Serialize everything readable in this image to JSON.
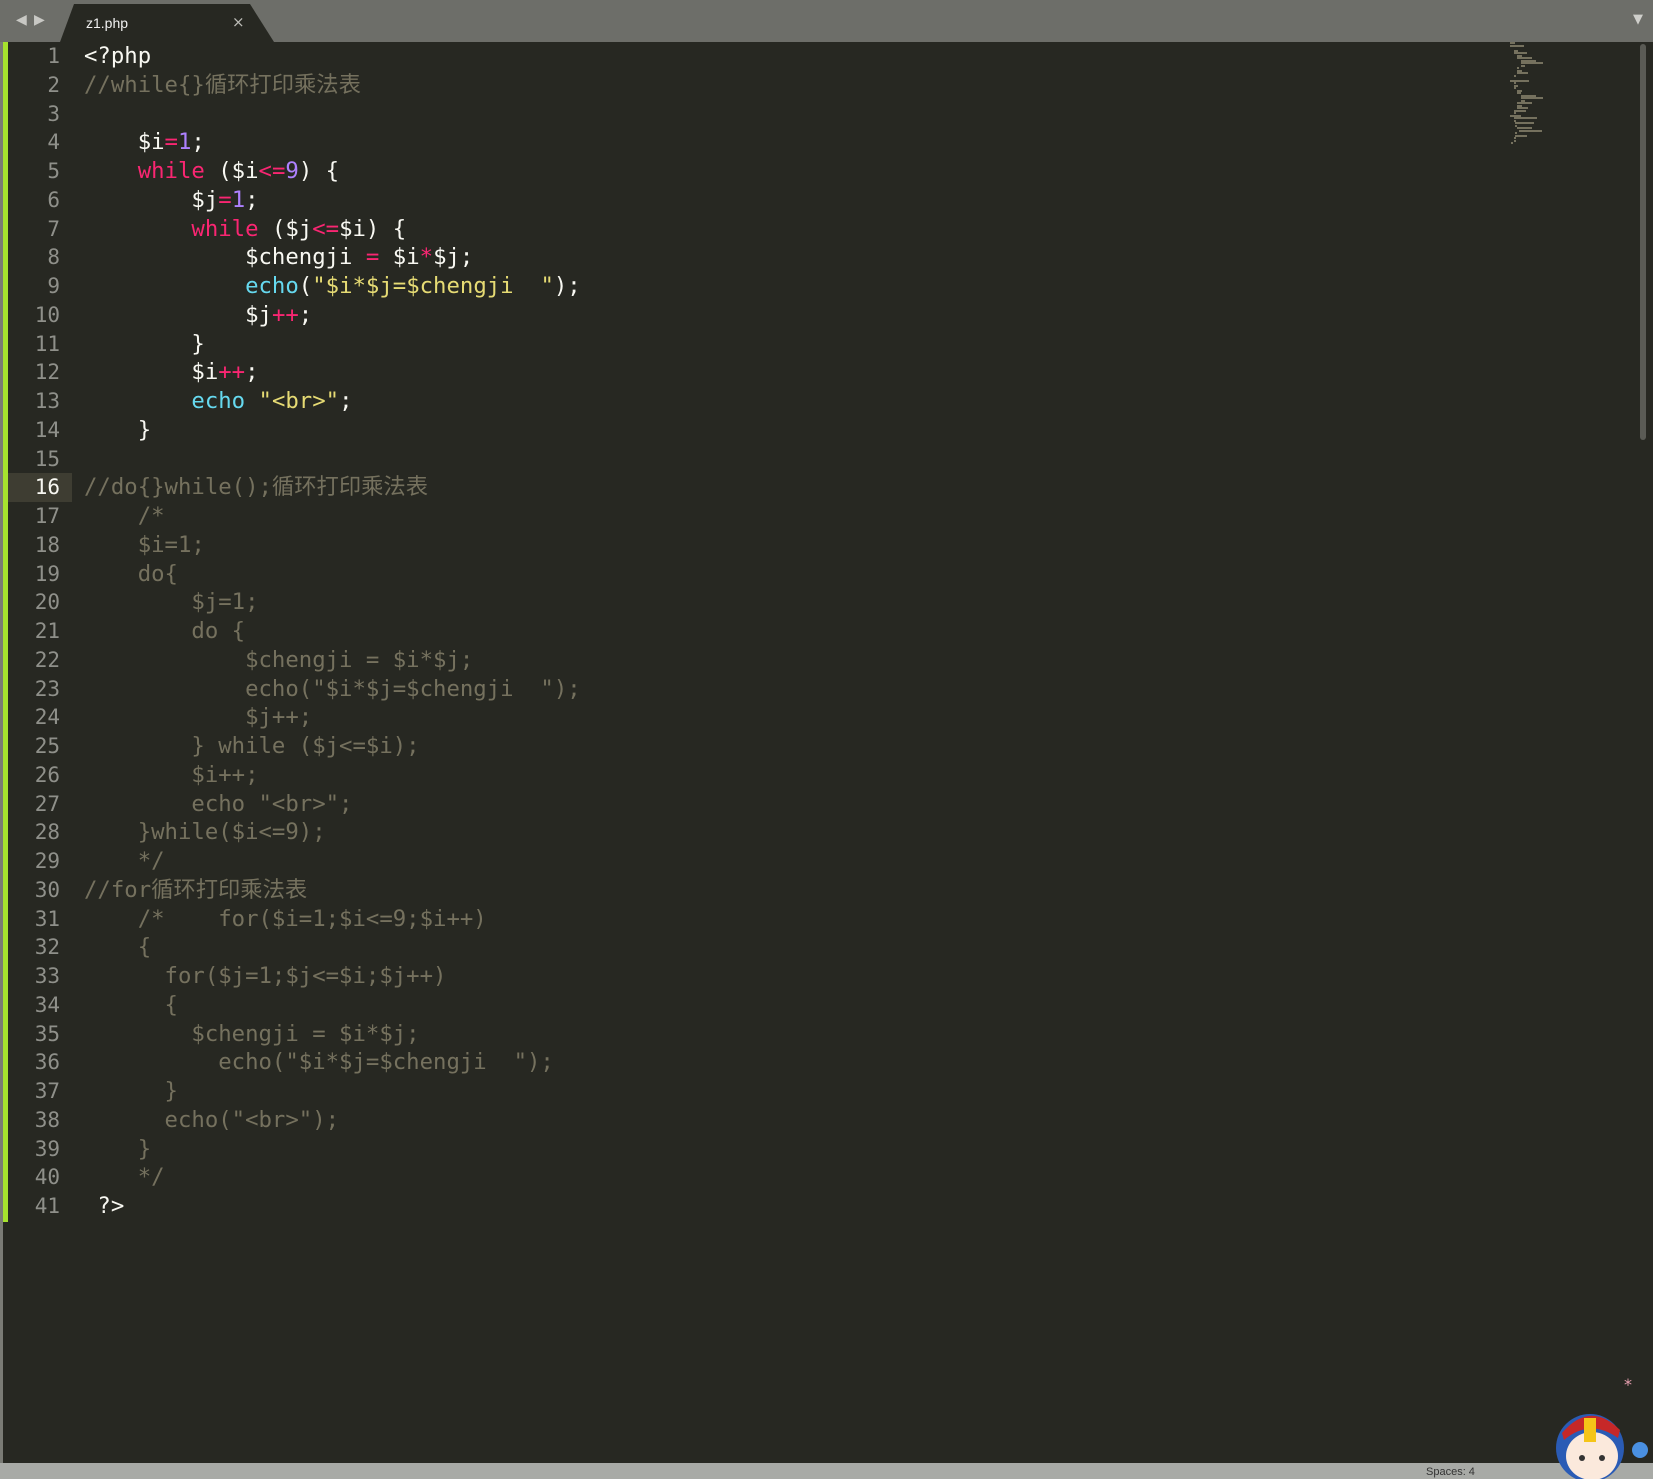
{
  "tab": {
    "filename": "z1.php",
    "close_glyph": "×"
  },
  "nav": {
    "back": "◀",
    "forward": "▶",
    "menu": "▼"
  },
  "status": {
    "spaces": "Spaces: 4"
  },
  "editor": {
    "current_line": 16,
    "lines": [
      [
        [
          "t",
          "<?php"
        ]
      ],
      [
        [
          "c",
          "//while{}循环打印乘法表"
        ]
      ],
      [],
      [
        [
          "t",
          "    $i"
        ],
        [
          "o",
          "="
        ],
        [
          "n",
          "1"
        ],
        [
          "t",
          ";"
        ]
      ],
      [
        [
          "k",
          "    while"
        ],
        [
          "t",
          " ($i"
        ],
        [
          "o",
          "<="
        ],
        [
          "n",
          "9"
        ],
        [
          "t",
          ") {"
        ]
      ],
      [
        [
          "t",
          "        $j"
        ],
        [
          "o",
          "="
        ],
        [
          "n",
          "1"
        ],
        [
          "t",
          ";"
        ]
      ],
      [
        [
          "k",
          "        while"
        ],
        [
          "t",
          " ($j"
        ],
        [
          "o",
          "<="
        ],
        [
          "t",
          "$i) {"
        ]
      ],
      [
        [
          "t",
          "            $chengji "
        ],
        [
          "o",
          "="
        ],
        [
          "t",
          " $i"
        ],
        [
          "o",
          "*"
        ],
        [
          "t",
          "$j;"
        ]
      ],
      [
        [
          "f",
          "            echo"
        ],
        [
          "t",
          "("
        ],
        [
          "s",
          "\"$i*$j=$chengji  \""
        ],
        [
          "t",
          ");"
        ]
      ],
      [
        [
          "t",
          "            $j"
        ],
        [
          "o",
          "++"
        ],
        [
          "t",
          ";"
        ]
      ],
      [
        [
          "t",
          "        }"
        ]
      ],
      [
        [
          "t",
          "        $i"
        ],
        [
          "o",
          "++"
        ],
        [
          "t",
          ";"
        ]
      ],
      [
        [
          "f",
          "        echo"
        ],
        [
          "t",
          " "
        ],
        [
          "s",
          "\"<br>\""
        ],
        [
          "t",
          ";"
        ]
      ],
      [
        [
          "t",
          "    }"
        ]
      ],
      [],
      [
        [
          "c",
          "//do{}while();循环打印乘法表"
        ]
      ],
      [
        [
          "c",
          "    /*"
        ]
      ],
      [
        [
          "c",
          "    $i=1;"
        ]
      ],
      [
        [
          "c",
          "    do{"
        ]
      ],
      [
        [
          "c",
          "        $j=1;"
        ]
      ],
      [
        [
          "c",
          "        do {"
        ]
      ],
      [
        [
          "c",
          "            $chengji = $i*$j;"
        ]
      ],
      [
        [
          "c",
          "            echo(\"$i*$j=$chengji  \");"
        ]
      ],
      [
        [
          "c",
          "            $j++;"
        ]
      ],
      [
        [
          "c",
          "        } while ($j<=$i);"
        ]
      ],
      [
        [
          "c",
          "        $i++;"
        ]
      ],
      [
        [
          "c",
          "        echo \"<br>\";"
        ]
      ],
      [
        [
          "c",
          "    }while($i<=9);"
        ]
      ],
      [
        [
          "c",
          "    */"
        ]
      ],
      [
        [
          "c",
          "//for循环打印乘法表"
        ]
      ],
      [
        [
          "c",
          "    /*    for($i=1;$i<=9;$i++)"
        ]
      ],
      [
        [
          "c",
          "    {"
        ]
      ],
      [
        [
          "c",
          "      for($j=1;$j<=$i;$j++)"
        ]
      ],
      [
        [
          "c",
          "      {"
        ]
      ],
      [
        [
          "c",
          "        $chengji = $i*$j;"
        ]
      ],
      [
        [
          "c",
          "          echo(\"$i*$j=$chengji  \");"
        ]
      ],
      [
        [
          "c",
          "      }"
        ]
      ],
      [
        [
          "c",
          "      echo(\"<br>\");"
        ]
      ],
      [
        [
          "c",
          "    }"
        ]
      ],
      [
        [
          "c",
          "    */"
        ]
      ],
      [
        [
          "t",
          " ?>"
        ]
      ]
    ]
  }
}
